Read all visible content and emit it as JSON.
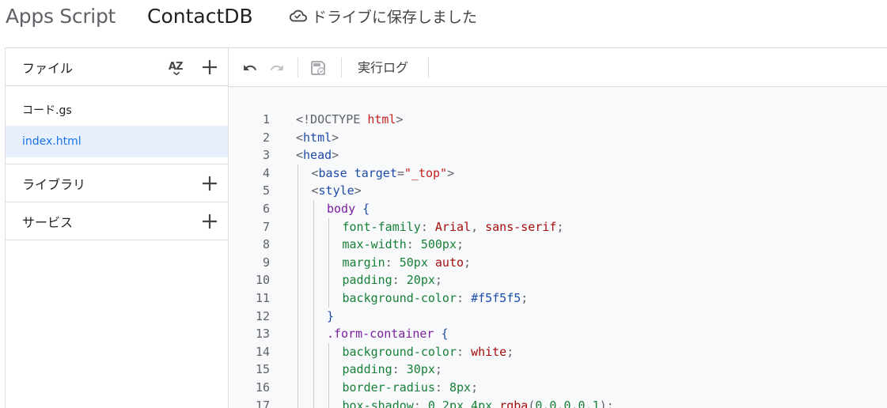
{
  "header": {
    "app_title": "Apps Script",
    "project_name": "ContactDB",
    "save_status": "ドライブに保存しました",
    "save_icon": "cloud-done-icon"
  },
  "sidebar": {
    "files_section": {
      "label": "ファイル",
      "sort_icon": "sort-az-icon",
      "add_icon": "plus-icon"
    },
    "files": [
      {
        "name": "コード.gs",
        "active": false
      },
      {
        "name": "index.html",
        "active": true
      }
    ],
    "libraries_section": {
      "label": "ライブラリ",
      "add_icon": "plus-icon"
    },
    "services_section": {
      "label": "サービス",
      "add_icon": "plus-icon"
    }
  },
  "toolbar": {
    "undo_icon": "undo-icon",
    "redo_icon": "redo-icon",
    "save_icon": "save-icon",
    "execution_log_label": "実行ログ"
  },
  "colors": {
    "accent": "#1a73e8",
    "active_file_bg": "#e8f0fe",
    "editor_bg": "#f8f9fa"
  },
  "editor": {
    "lines": [
      {
        "n": "1",
        "indent": 0,
        "tokens": [
          [
            "punc",
            "<!DOCTYPE "
          ],
          [
            "keyword",
            "html"
          ],
          [
            "punc",
            ">"
          ]
        ]
      },
      {
        "n": "2",
        "indent": 0,
        "tokens": [
          [
            "punc",
            "<"
          ],
          [
            "tag",
            "html"
          ],
          [
            "punc",
            ">"
          ]
        ]
      },
      {
        "n": "3",
        "indent": 0,
        "tokens": [
          [
            "punc",
            "<"
          ],
          [
            "tag",
            "head"
          ],
          [
            "punc",
            ">"
          ]
        ]
      },
      {
        "n": "4",
        "indent": 1,
        "tokens": [
          [
            "punc",
            "<"
          ],
          [
            "tag",
            "base "
          ],
          [
            "attr",
            "target"
          ],
          [
            "punc",
            "="
          ],
          [
            "str",
            "\"_top\""
          ],
          [
            "punc",
            ">"
          ]
        ]
      },
      {
        "n": "5",
        "indent": 1,
        "tokens": [
          [
            "punc",
            "<"
          ],
          [
            "tag",
            "style"
          ],
          [
            "punc",
            ">"
          ]
        ]
      },
      {
        "n": "6",
        "indent": 2,
        "tokens": [
          [
            "sel",
            "body "
          ],
          [
            "brace",
            "{"
          ]
        ]
      },
      {
        "n": "7",
        "indent": 3,
        "tokens": [
          [
            "prop",
            "font-family"
          ],
          [
            "punc",
            ": "
          ],
          [
            "val",
            "Arial"
          ],
          [
            "punc",
            ", "
          ],
          [
            "val",
            "sans-serif"
          ],
          [
            "punc",
            ";"
          ]
        ]
      },
      {
        "n": "8",
        "indent": 3,
        "tokens": [
          [
            "prop",
            "max-width"
          ],
          [
            "punc",
            ": "
          ],
          [
            "num",
            "500px"
          ],
          [
            "punc",
            ";"
          ]
        ]
      },
      {
        "n": "9",
        "indent": 3,
        "tokens": [
          [
            "prop",
            "margin"
          ],
          [
            "punc",
            ": "
          ],
          [
            "num",
            "50px "
          ],
          [
            "val",
            "auto"
          ],
          [
            "punc",
            ";"
          ]
        ]
      },
      {
        "n": "10",
        "indent": 3,
        "tokens": [
          [
            "prop",
            "padding"
          ],
          [
            "punc",
            ": "
          ],
          [
            "num",
            "20px"
          ],
          [
            "punc",
            ";"
          ]
        ]
      },
      {
        "n": "11",
        "indent": 3,
        "tokens": [
          [
            "prop",
            "background-color"
          ],
          [
            "punc",
            ": "
          ],
          [
            "hex",
            "#f5f5f5"
          ],
          [
            "punc",
            ";"
          ]
        ]
      },
      {
        "n": "12",
        "indent": 2,
        "tokens": [
          [
            "brace",
            "}"
          ]
        ]
      },
      {
        "n": "13",
        "indent": 2,
        "tokens": [
          [
            "sel",
            ".form-container "
          ],
          [
            "brace",
            "{"
          ]
        ]
      },
      {
        "n": "14",
        "indent": 3,
        "tokens": [
          [
            "prop",
            "background-color"
          ],
          [
            "punc",
            ": "
          ],
          [
            "val",
            "white"
          ],
          [
            "punc",
            ";"
          ]
        ]
      },
      {
        "n": "15",
        "indent": 3,
        "tokens": [
          [
            "prop",
            "padding"
          ],
          [
            "punc",
            ": "
          ],
          [
            "num",
            "30px"
          ],
          [
            "punc",
            ";"
          ]
        ]
      },
      {
        "n": "16",
        "indent": 3,
        "tokens": [
          [
            "prop",
            "border-radius"
          ],
          [
            "punc",
            ": "
          ],
          [
            "num",
            "8px"
          ],
          [
            "punc",
            ";"
          ]
        ]
      },
      {
        "n": "17",
        "indent": 3,
        "tokens": [
          [
            "prop",
            "box-shadow"
          ],
          [
            "punc",
            ": "
          ],
          [
            "num",
            "0 2px 4px "
          ],
          [
            "val",
            "rgba"
          ],
          [
            "punc",
            "("
          ],
          [
            "num",
            "0,0,0,0.1"
          ],
          [
            "punc",
            ");"
          ]
        ]
      }
    ]
  }
}
